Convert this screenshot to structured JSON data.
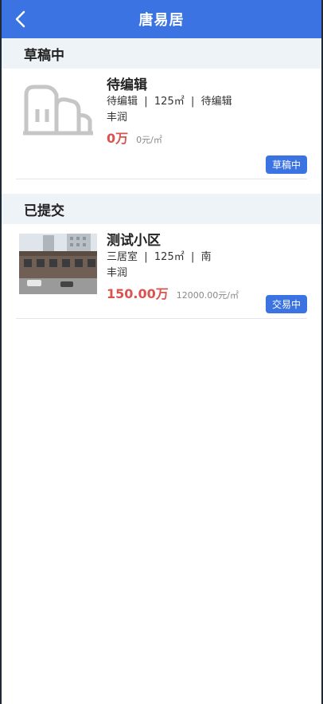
{
  "header": {
    "title": "唐易居",
    "back_icon": "chevron-left-icon"
  },
  "sections": [
    {
      "title": "草稿中",
      "items": [
        {
          "title": "待编辑",
          "details": "待编辑  |  125㎡  |  待编辑",
          "area": "丰润",
          "price": "0万",
          "unit_price": "0元/㎡",
          "status": "草稿中",
          "image": "building-placeholder-icon"
        }
      ]
    },
    {
      "title": "已提交",
      "items": [
        {
          "title": "测试小区",
          "details": "三居室  |  125㎡  |  南",
          "area": "丰润",
          "price": "150.00万",
          "unit_price": "12000.00元/㎡",
          "status": "交易中",
          "image": "property-photo"
        }
      ]
    }
  ],
  "colors": {
    "nav": "#3b73e2",
    "price": "#d9534f",
    "badge": "#3b73e2",
    "section_bg": "#eef3f8"
  }
}
